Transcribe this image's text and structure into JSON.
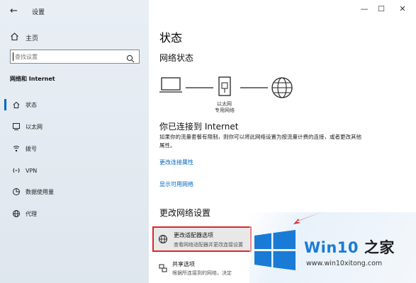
{
  "window": {
    "back_glyph": "←",
    "title": "设置",
    "controls": {
      "minimize": "—",
      "maximize": "☐",
      "close": "✕"
    }
  },
  "sidebar": {
    "home_label": "主页",
    "search": {
      "placeholder": "查找设置",
      "value": ""
    },
    "section_title": "网络和 Internet",
    "items": [
      {
        "label": "状态",
        "icon": "home-network-icon",
        "selected": true
      },
      {
        "label": "以太网",
        "icon": "ethernet-icon",
        "selected": false
      },
      {
        "label": "拨号",
        "icon": "dialup-icon",
        "selected": false
      },
      {
        "label": "VPN",
        "icon": "vpn-icon",
        "selected": false
      },
      {
        "label": "数据使用量",
        "icon": "data-usage-icon",
        "selected": false
      },
      {
        "label": "代理",
        "icon": "globe-icon",
        "selected": false
      }
    ]
  },
  "main": {
    "title": "状态",
    "network_status_heading": "网络状态",
    "device_label_line1": "以太网",
    "device_label_line2": "专用网络",
    "connected_heading": "你已连接到 Internet",
    "connected_desc": "如果你的流量套餐有限制，则你可以将此网络设置为按流量计费的连接，或者更改其他属性。",
    "link_change_props": "更改连接属性",
    "link_show_networks": "显示可用网络",
    "change_heading": "更改网络设置",
    "adapter_title": "更改适配器选项",
    "adapter_sub": "查看网络适配器并更改连接设置",
    "share_title": "共享选项",
    "share_sub": "根据所连接到的网络，决定"
  },
  "watermark": {
    "brand_win": "Win10",
    "brand_rest": " 之家",
    "url": "www.win10xitong.com"
  },
  "colors": {
    "accent": "#0067c0",
    "highlight_border": "#d9262b",
    "sidebar_bg": "#e4ebf1",
    "logo_blue": "#1a7bd6"
  }
}
